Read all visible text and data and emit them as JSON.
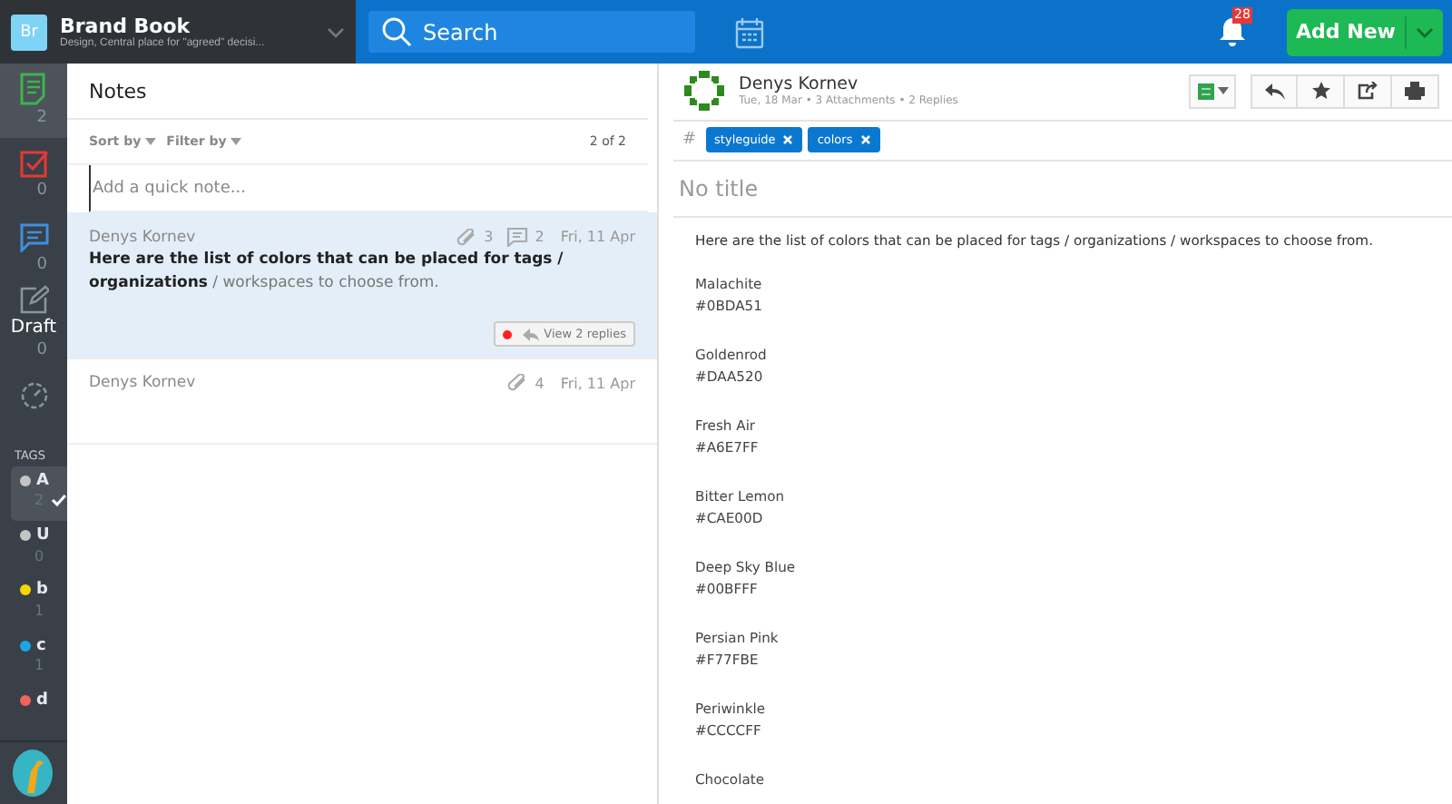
{
  "workspace": {
    "initials": "Br",
    "name": "Brand Book",
    "description": "Design, Central place for \"agreed\" decisi..."
  },
  "search": {
    "placeholder": "Search"
  },
  "notifications": {
    "count": "28"
  },
  "add_button": {
    "label": "Add New"
  },
  "rail": {
    "items": [
      {
        "kind": "notes",
        "count": "2",
        "selected": true
      },
      {
        "kind": "tasks",
        "count": "0",
        "selected": false
      },
      {
        "kind": "chat",
        "count": "0",
        "selected": false
      },
      {
        "kind": "drafts",
        "label": "Draft",
        "count": "0",
        "selected": false
      },
      {
        "kind": "gauge",
        "selected": false
      }
    ],
    "tags_heading": "TAGS",
    "tags": [
      {
        "label": "A",
        "count": "2",
        "color": "#c4c4c4",
        "selected": true
      },
      {
        "label": "U",
        "count": "0",
        "color": "#c4c4c4",
        "selected": false
      },
      {
        "label": "b",
        "count": "1",
        "color": "#f5d800",
        "selected": false
      },
      {
        "label": "c",
        "count": "1",
        "color": "#1aa6e8",
        "selected": false
      },
      {
        "label": "d",
        "color": "#f0645a",
        "selected": false
      }
    ]
  },
  "notes": {
    "title": "Notes",
    "sort_label": "Sort by",
    "filter_label": "Filter by",
    "counter": "2 of 2",
    "quick_note": {
      "placeholder": "Add a quick note..."
    },
    "items": [
      {
        "author": "Denys Kornev",
        "attachments": "3",
        "comments": "2",
        "date": "Fri, 11 Apr",
        "text": "**Here are the list of colors that can be placed for tags / organizations** / workspaces to choose from.",
        "replies_button": "View 2 replies",
        "unread": true,
        "selected": true
      },
      {
        "author": "Denys Kornev",
        "attachments": "4",
        "date": "Fri, 11 Apr",
        "selected": false
      }
    ]
  },
  "detail": {
    "author": "Denys Kornev",
    "meta": "Tue, 18 Mar • 3 Attachments • 2 Replies",
    "tag_prefix": "#",
    "tags": [
      "styleguide",
      "colors"
    ],
    "title_placeholder": "No title",
    "intro": "Here are the list of colors that can be placed for tags / organizations / workspaces to choose from.",
    "colors": [
      {
        "name": "Malachite",
        "hex": "#0BDA51"
      },
      {
        "name": "Goldenrod",
        "hex": "#DAA520"
      },
      {
        "name": "Fresh Air",
        "hex": "#A6E7FF"
      },
      {
        "name": "Bitter Lemon",
        "hex": "#CAE00D"
      },
      {
        "name": "Deep Sky Blue",
        "hex": "#00BFFF"
      },
      {
        "name": "Persian Pink",
        "hex": "#F77FBE"
      },
      {
        "name": "Periwinkle",
        "hex": "#CCCCFF"
      },
      {
        "name": "Chocolate"
      }
    ]
  }
}
